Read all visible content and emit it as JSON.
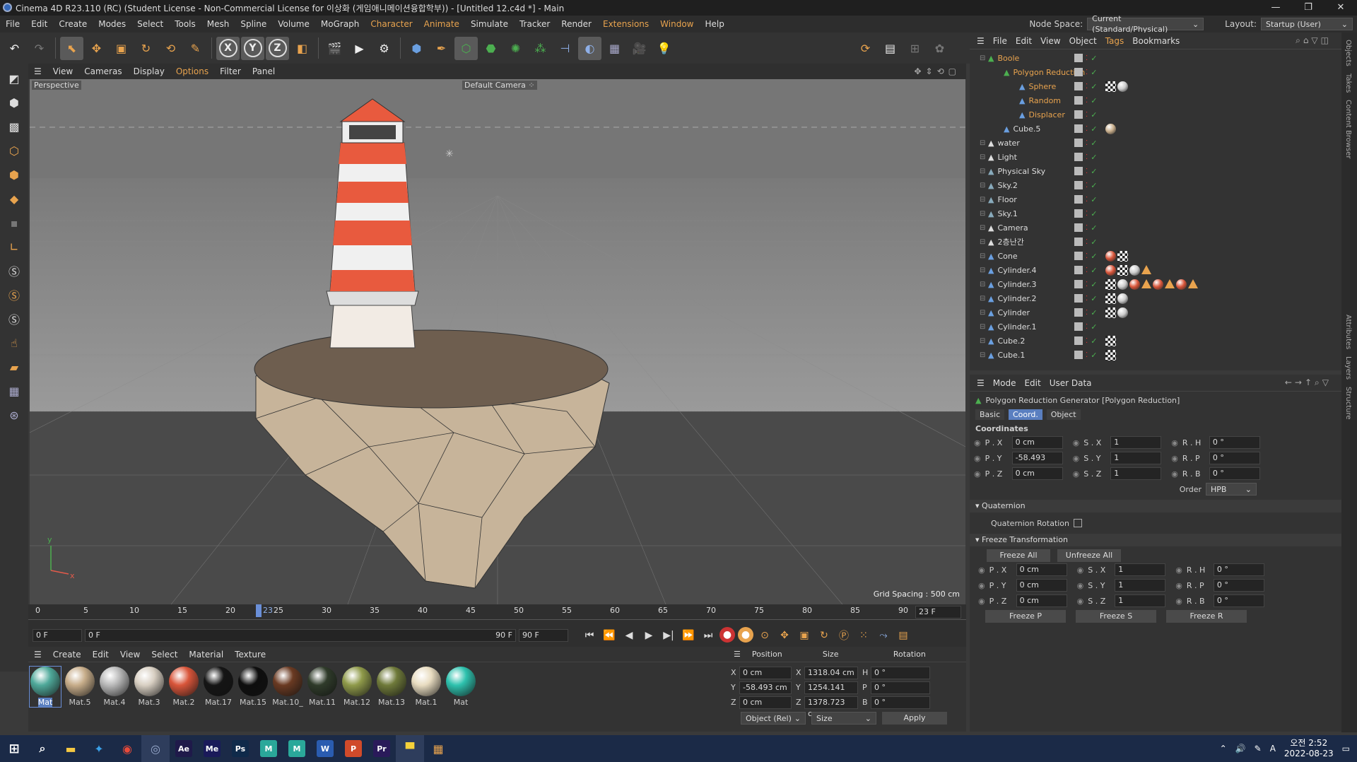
{
  "window": {
    "title": "Cinema 4D R23.110 (RC) (Student License - Non-Commercial License for 이상화 (게임애니메이션융합학부)) - [Untitled 12.c4d *] - Main",
    "min": "—",
    "max": "❐",
    "close": "✕"
  },
  "menu": {
    "items": [
      "File",
      "Edit",
      "Create",
      "Modes",
      "Select",
      "Tools",
      "Mesh",
      "Spline",
      "Volume",
      "MoGraph",
      "Character",
      "Animate",
      "Simulate",
      "Tracker",
      "Render",
      "Extensions",
      "Window",
      "Help"
    ],
    "node_space_label": "Node Space:",
    "node_space_value": "Current (Standard/Physical)",
    "layout_label": "Layout:",
    "layout_value": "Startup (User)"
  },
  "toolbar": {
    "x": "X",
    "y": "Y",
    "z": "Z"
  },
  "viewport_menu": [
    "View",
    "Cameras",
    "Display",
    "Options",
    "Filter",
    "Panel"
  ],
  "viewport": {
    "label": "Perspective",
    "camera": "Default Camera ⁘",
    "grid_spacing": "Grid Spacing : 500 cm",
    "axis_y": "y",
    "axis_x": "x"
  },
  "timeline": {
    "ticks": [
      "0",
      "5",
      "10",
      "15",
      "20",
      "25",
      "30",
      "35",
      "40",
      "45",
      "50",
      "55",
      "60",
      "65",
      "70",
      "75",
      "80",
      "85",
      "90"
    ],
    "current_marker": "23",
    "current_frame_field": "23 F",
    "start": "0 F",
    "range_start": "0 F",
    "range_end": "90 F",
    "end": "90 F"
  },
  "material_menu": [
    "Create",
    "Edit",
    "View",
    "Select",
    "Material",
    "Texture"
  ],
  "materials": [
    {
      "name": "Mat",
      "color": "#4fa99a"
    },
    {
      "name": "Mat.5",
      "color": "#c7ad8a"
    },
    {
      "name": "Mat.4",
      "color": "#b9b9b9"
    },
    {
      "name": "Mat.3",
      "color": "#d8cfc2"
    },
    {
      "name": "Mat.2",
      "color": "#d9553a"
    },
    {
      "name": "Mat.17",
      "color": "#151515"
    },
    {
      "name": "Mat.15",
      "color": "#0e0e0e"
    },
    {
      "name": "Mat.10_",
      "color": "#6a3a22"
    },
    {
      "name": "Mat.11",
      "color": "#2f3b2a"
    },
    {
      "name": "Mat.12",
      "color": "#8f9a4a"
    },
    {
      "name": "Mat.13",
      "color": "#6f7a3a"
    },
    {
      "name": "Mat.1",
      "color": "#e8dcc0"
    },
    {
      "name": "Mat",
      "color": "#2ec2ae"
    }
  ],
  "coords": {
    "headers": [
      "Position",
      "Size",
      "Rotation"
    ],
    "rows": [
      {
        "axis": "X",
        "pos": "0 cm",
        "sax": "X",
        "size": "1318.04 cm",
        "rax": "H",
        "rot": "0 °"
      },
      {
        "axis": "Y",
        "pos": "-58.493 cm",
        "sax": "Y",
        "size": "1254.141 cm",
        "rax": "P",
        "rot": "0 °"
      },
      {
        "axis": "Z",
        "pos": "0 cm",
        "sax": "Z",
        "size": "1378.723 cm",
        "rax": "B",
        "rot": "0 °"
      }
    ],
    "mode": "Object (Rel)",
    "size_mode": "Size",
    "apply": "Apply"
  },
  "object_manager": {
    "menu": [
      "File",
      "Edit",
      "View",
      "Object",
      "Tags",
      "Bookmarks"
    ],
    "objects": [
      {
        "name": "Boole",
        "indent": 0,
        "orange": true,
        "icon": "#4caf50",
        "tags": []
      },
      {
        "name": "Polygon Reduction",
        "indent": 1,
        "orange": true,
        "icon": "#4caf50",
        "tags": []
      },
      {
        "name": "Sphere",
        "indent": 2,
        "orange": true,
        "icon": "#6a9fe0",
        "tags": [
          "chk",
          "#ccc"
        ]
      },
      {
        "name": "Random",
        "indent": 2,
        "orange": true,
        "icon": "#6a9fe0",
        "tags": []
      },
      {
        "name": "Displacer",
        "indent": 2,
        "orange": true,
        "icon": "#6a9fe0",
        "tags": []
      },
      {
        "name": "Cube.5",
        "indent": 1,
        "orange": false,
        "icon": "#6a9fe0",
        "tags": [
          "#c7ad8a"
        ]
      },
      {
        "name": "water",
        "indent": 0,
        "orange": false,
        "icon": "#ddd",
        "tags": []
      },
      {
        "name": "Light",
        "indent": 0,
        "orange": false,
        "icon": "#ddd",
        "tags": []
      },
      {
        "name": "Physical Sky",
        "indent": 0,
        "orange": false,
        "icon": "#8ab",
        "tags": []
      },
      {
        "name": "Sky.2",
        "indent": 0,
        "orange": false,
        "icon": "#8ab",
        "tags": []
      },
      {
        "name": "Floor",
        "indent": 0,
        "orange": false,
        "icon": "#8ab",
        "tags": []
      },
      {
        "name": "Sky.1",
        "indent": 0,
        "orange": false,
        "icon": "#8ab",
        "tags": []
      },
      {
        "name": "Camera",
        "indent": 0,
        "orange": false,
        "icon": "#ddd",
        "tags": []
      },
      {
        "name": "2층난간",
        "indent": 0,
        "orange": false,
        "icon": "#ddd",
        "tags": []
      },
      {
        "name": "Cone",
        "indent": 0,
        "orange": false,
        "icon": "#6a9fe0",
        "tags": [
          "#d9553a",
          "chk"
        ]
      },
      {
        "name": "Cylinder.4",
        "indent": 0,
        "orange": false,
        "icon": "#6a9fe0",
        "tags": [
          "#d9553a",
          "chk",
          "#ccc",
          "tri"
        ]
      },
      {
        "name": "Cylinder.3",
        "indent": 0,
        "orange": false,
        "icon": "#6a9fe0",
        "tags": [
          "chk",
          "#ccc",
          "#d9553a",
          "tri",
          "#d9553a",
          "tri",
          "#d9553a",
          "tri"
        ]
      },
      {
        "name": "Cylinder.2",
        "indent": 0,
        "orange": false,
        "icon": "#6a9fe0",
        "tags": [
          "chk",
          "#ccc"
        ]
      },
      {
        "name": "Cylinder",
        "indent": 0,
        "orange": false,
        "icon": "#6a9fe0",
        "tags": [
          "chk",
          "#ccc"
        ]
      },
      {
        "name": "Cylinder.1",
        "indent": 0,
        "orange": false,
        "icon": "#6a9fe0",
        "tags": []
      },
      {
        "name": "Cube.2",
        "indent": 0,
        "orange": false,
        "icon": "#6a9fe0",
        "tags": [
          "chk"
        ]
      },
      {
        "name": "Cube.1",
        "indent": 0,
        "orange": false,
        "icon": "#6a9fe0",
        "tags": [
          "chk"
        ]
      }
    ]
  },
  "attributes": {
    "menu": [
      "Mode",
      "Edit",
      "User Data"
    ],
    "object_title": "Polygon Reduction Generator [Polygon Reduction]",
    "tabs": [
      "Basic",
      "Coord.",
      "Object"
    ],
    "section": "Coordinates",
    "coords": [
      {
        "p": "P . X",
        "pv": "0 cm",
        "s": "S . X",
        "sv": "1",
        "r": "R . H",
        "rv": "0 °"
      },
      {
        "p": "P . Y",
        "pv": "-58.493 cm",
        "s": "S . Y",
        "sv": "1",
        "r": "R . P",
        "rv": "0 °"
      },
      {
        "p": "P . Z",
        "pv": "0 cm",
        "s": "S . Z",
        "sv": "1",
        "r": "R . B",
        "rv": "0 °"
      }
    ],
    "order_label": "Order",
    "order_value": "HPB",
    "quaternion": "Quaternion",
    "quaternion_rotation": "Quaternion Rotation",
    "freeze": "Freeze Transformation",
    "freeze_all": "Freeze All",
    "unfreeze_all": "Unfreeze All",
    "freeze_coords": [
      {
        "p": "P . X",
        "pv": "0 cm",
        "s": "S . X",
        "sv": "1",
        "r": "R . H",
        "rv": "0 °"
      },
      {
        "p": "P . Y",
        "pv": "0 cm",
        "s": "S . Y",
        "sv": "1",
        "r": "R . P",
        "rv": "0 °"
      },
      {
        "p": "P . Z",
        "pv": "0 cm",
        "s": "S . Z",
        "sv": "1",
        "r": "R . B",
        "rv": "0 °"
      }
    ],
    "freeze_p": "Freeze P",
    "freeze_s": "Freeze S",
    "freeze_r": "Freeze R"
  },
  "right_tabs": [
    "Objects",
    "Takes",
    "Content Browser",
    "Attributes",
    "Layers",
    "Structure"
  ],
  "taskbar": {
    "apps": [
      {
        "label": "Ae",
        "color": "#1f1a4a"
      },
      {
        "label": "Me",
        "color": "#1a1a5a"
      },
      {
        "label": "Ps",
        "color": "#0f2a4a"
      },
      {
        "label": "M",
        "color": "#2aa89a"
      },
      {
        "label": "M",
        "color": "#2aa89a"
      },
      {
        "label": "W",
        "color": "#2a5cb0"
      },
      {
        "label": "P",
        "color": "#d04a2a"
      },
      {
        "label": "Pr",
        "color": "#2a1a5a"
      }
    ],
    "time": "오전 2:52",
    "date": "2022-08-23",
    "ime": "A"
  }
}
